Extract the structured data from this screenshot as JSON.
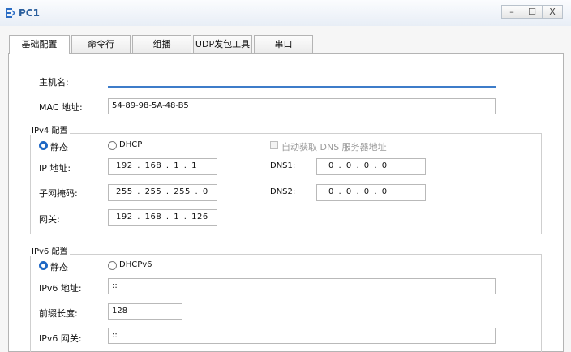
{
  "window": {
    "title": "PC1",
    "minimize": "–",
    "maximize": "☐",
    "close": "X"
  },
  "tabs": [
    "基础配置",
    "命令行",
    "组播",
    "UDP发包工具",
    "串口"
  ],
  "basic": {
    "hostname_label": "主机名:",
    "hostname_value": "",
    "mac_label": "MAC 地址:",
    "mac_value": "54-89-98-5A-48-B5"
  },
  "ipv4": {
    "group_title": "IPv4 配置",
    "static_label": "静态",
    "dhcp_label": "DHCP",
    "auto_dns_label": "自动获取 DNS 服务器地址",
    "ip_label": "IP 地址:",
    "ip_value": "192 . 168 . 1 . 1",
    "mask_label": "子网掩码:",
    "mask_value": "255 . 255 . 255 . 0",
    "gateway_label": "网关:",
    "gateway_value": "192 . 168 . 1 . 126",
    "dns1_label": "DNS1:",
    "dns1_value": "0 . 0 . 0 . 0",
    "dns2_label": "DNS2:",
    "dns2_value": "0 . 0 . 0 . 0"
  },
  "ipv6": {
    "group_title": "IPv6 配置",
    "static_label": "静态",
    "dhcp_label": "DHCPv6",
    "addr_label": "IPv6 地址:",
    "addr_value": "::",
    "prefix_label": "前缀长度:",
    "prefix_value": "128",
    "gateway_label": "IPv6 网关:",
    "gateway_value": "::"
  }
}
